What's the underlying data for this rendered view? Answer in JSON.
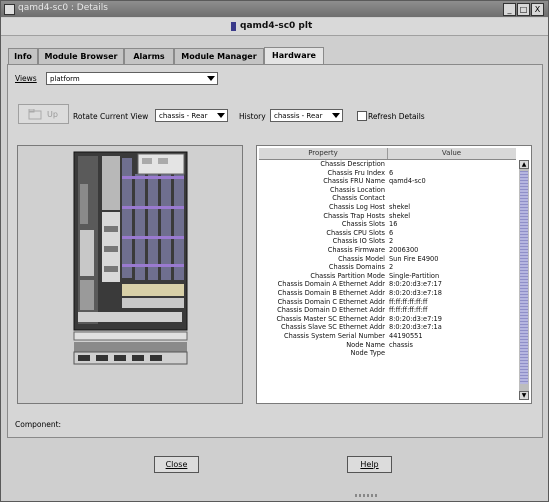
{
  "window": {
    "title": "qamd4-sc0 : Details",
    "header_title": "qamd4-sc0 plt",
    "minimize": "_",
    "maximize": "□",
    "close": "X"
  },
  "tabs": [
    {
      "label": "Info",
      "active": false
    },
    {
      "label": "Module Browser",
      "active": false
    },
    {
      "label": "Alarms",
      "active": false
    },
    {
      "label": "Module Manager",
      "active": false
    },
    {
      "label": "Hardware",
      "active": true
    }
  ],
  "toolbar": {
    "views_label": "Views",
    "views_value": "platform",
    "up_label": "Up",
    "rotate_label": "Rotate Current View",
    "rotate_value": "chassis - Rear",
    "history_label": "History",
    "history_value": "chassis - Rear",
    "refresh_label": "Refresh Details",
    "refresh_checked": false
  },
  "properties": {
    "columns": [
      "Property",
      "Value"
    ],
    "rows": [
      {
        "k": "Chassis Description",
        "v": ""
      },
      {
        "k": "Chassis Fru Index",
        "v": "6"
      },
      {
        "k": "Chassis FRU Name",
        "v": "qamd4-sc0"
      },
      {
        "k": "Chassis Location",
        "v": ""
      },
      {
        "k": "Chassis Contact",
        "v": ""
      },
      {
        "k": "Chassis Log Host",
        "v": "shekel"
      },
      {
        "k": "Chassis Trap Hosts",
        "v": "shekel"
      },
      {
        "k": "Chassis Slots",
        "v": "16"
      },
      {
        "k": "Chassis CPU Slots",
        "v": "6"
      },
      {
        "k": "Chassis IO Slots",
        "v": "2"
      },
      {
        "k": "Chassis Firmware",
        "v": "2006300"
      },
      {
        "k": "Chassis Model",
        "v": "Sun Fire E4900"
      },
      {
        "k": "Chassis Domains",
        "v": "2"
      },
      {
        "k": "Chassis Partition Mode",
        "v": "Single-Partition"
      },
      {
        "k": "Chassis Domain A Ethernet Addr",
        "v": "8:0:20:d3:e7:17"
      },
      {
        "k": "Chassis Domain B Ethernet Addr",
        "v": "8:0:20:d3:e7:18"
      },
      {
        "k": "Chassis Domain C Ethernet Addr",
        "v": "ff:ff:ff:ff:ff:ff"
      },
      {
        "k": "Chassis Domain D Ethernet Addr",
        "v": "ff:ff:ff:ff:ff:ff"
      },
      {
        "k": "Chassis Master SC Ethernet Addr",
        "v": "8:0:20:d3:e7:19"
      },
      {
        "k": "Chassis Slave SC Ethernet Addr",
        "v": "8:0:20:d3:e7:1a"
      },
      {
        "k": "Chassis System Serial Number",
        "v": "44190551"
      },
      {
        "k": "Node Name",
        "v": "chassis"
      },
      {
        "k": "Node Type",
        "v": ""
      }
    ]
  },
  "component_label": "Component:",
  "buttons": {
    "close": "Close",
    "help": "Help"
  }
}
